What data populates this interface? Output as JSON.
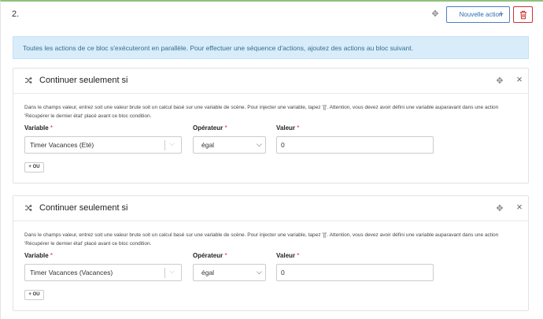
{
  "block": {
    "number": "2.",
    "new_action_label": "Nouvelle action",
    "info": "Toutes les actions de ce bloc s'exécuteront en parallèle. Pour effectuer une séquence d'actions, ajoutez des actions au bloc suivant."
  },
  "conditions": [
    {
      "title": "Continuer seulement si",
      "description_line1": "Dans le champs valeur, entrez soit une valeur brute soit un calcul basé sur une variable de scène. Pour injecter une variable, tapez '[['. Attention, vous devez avoir défini une variable auparavant dans une action",
      "description_line2": "'Récupérer le dernier état' placé avant ce bloc condition.",
      "variable_label": "Variable",
      "operator_label": "Opérateur",
      "value_label": "Valeur",
      "required_mark": "*",
      "variable_value": "Timer Vacances (Eté)",
      "operator_value": "égal",
      "value": "0",
      "ou_label": "+ OU"
    },
    {
      "title": "Continuer seulement si",
      "description_line1": "Dans le champs valeur, entrez soit une valeur brute soit un calcul basé sur une variable de scène. Pour injecter une variable, tapez '[['. Attention, vous devez avoir défini une variable auparavant dans une action",
      "description_line2": "'Récupérer le dernier état' placé avant ce bloc condition.",
      "variable_label": "Variable",
      "operator_label": "Opérateur",
      "value_label": "Valeur",
      "required_mark": "*",
      "variable_value": "Timer Vacances (Vacances)",
      "operator_value": "égal",
      "value": "0",
      "ou_label": "+ OU"
    }
  ],
  "colors": {
    "accent_blue": "#2f6db4",
    "danger_red": "#d32f2f",
    "info_background": "#d9ecfa",
    "block_top_border": "#8ec07c"
  },
  "icons": {
    "move": "move-icon",
    "plus": "plus-icon",
    "delete": "trash-icon",
    "condition": "shuffle-icon",
    "close": "close-icon",
    "dropdown": "chevron-down-icon"
  }
}
